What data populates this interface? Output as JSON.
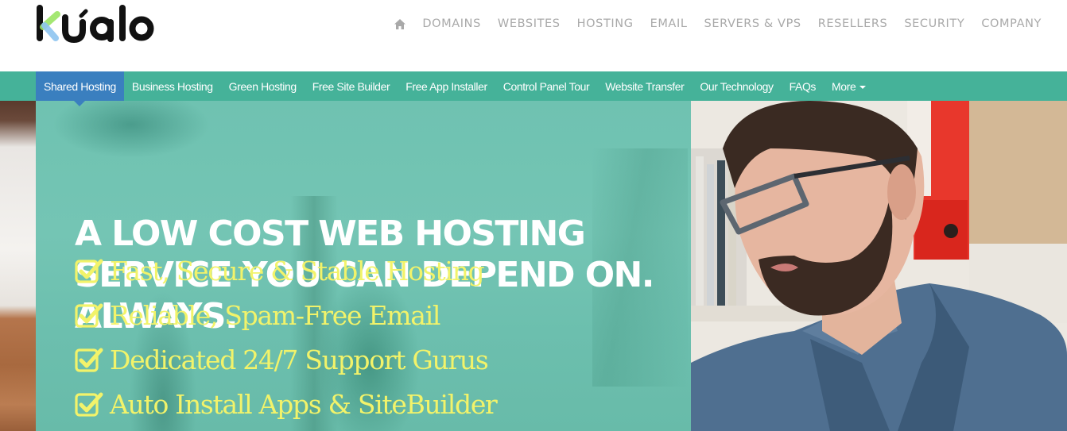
{
  "brand": {
    "logo_text": "kualo",
    "colors": {
      "logo_dark": "#111111",
      "logo_green": "#9be564",
      "logo_blue": "#8ec5f0"
    }
  },
  "main_nav": {
    "home_icon": "home-icon",
    "items": [
      {
        "label": "DOMAINS"
      },
      {
        "label": "WEBSITES"
      },
      {
        "label": "HOSTING"
      },
      {
        "label": "EMAIL"
      },
      {
        "label": "SERVERS & VPS"
      },
      {
        "label": "RESELLERS"
      },
      {
        "label": "SECURITY"
      },
      {
        "label": "COMPANY"
      }
    ]
  },
  "sub_nav": {
    "active_index": 0,
    "items": [
      {
        "label": "Shared Hosting"
      },
      {
        "label": "Business Hosting"
      },
      {
        "label": "Green Hosting"
      },
      {
        "label": "Free Site Builder"
      },
      {
        "label": "Free App Installer"
      },
      {
        "label": "Control Panel Tour"
      },
      {
        "label": "Website Transfer"
      },
      {
        "label": "Our Technology"
      },
      {
        "label": "FAQs"
      },
      {
        "label": "More"
      }
    ],
    "more_icon": "caret-down-icon",
    "colors": {
      "bar": "#45b299",
      "active": "#3a7fbf",
      "text": "#ffffff"
    }
  },
  "hero": {
    "headline_lines": [
      "A LOW COST WEB HOSTING",
      "SERVICE YOU CAN DEPEND ON.",
      "ALWAYS."
    ],
    "features": [
      {
        "icon": "checkbox-checked-icon",
        "label": "Fast, Secure & Stable Hosting"
      },
      {
        "icon": "checkbox-checked-icon",
        "label": "Reliable, Spam-Free Email"
      },
      {
        "icon": "checkbox-checked-icon",
        "label": "Dedicated 24/7 Support Gurus"
      },
      {
        "icon": "checkbox-checked-icon",
        "label": "Auto Install Apps & SiteBuilder"
      }
    ],
    "photo_alt": "man-with-glasses-photo",
    "colors": {
      "panel": "#6fc2b1",
      "headline": "#ffffff",
      "feature_text": "#f2f36a"
    }
  }
}
